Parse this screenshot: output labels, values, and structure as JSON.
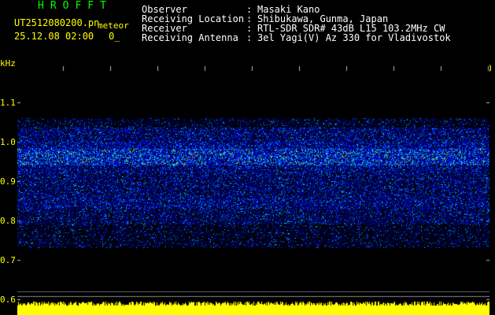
{
  "header": {
    "app_title": "HROFFT",
    "filename": "UT2512080200.pn",
    "meteor_label": "meteor",
    "datetime": "25.12.08 02:00",
    "count": "0_"
  },
  "info": [
    {
      "label": "Observer",
      "value": "Masaki Kano"
    },
    {
      "label": "Receiving Location",
      "value": "Shibukawa, Gunma, Japan"
    },
    {
      "label": "Receiver",
      "value": "RTL-SDR SDR# 43dB L15 103.2MHz CW"
    },
    {
      "label": "Receiving Antenna",
      "value": "3el Yagi(V) Az 330 for Vladivostok"
    }
  ],
  "axis": {
    "y_unit": "kHz",
    "y_ticks": [
      "1.1",
      "1.0",
      "0.9",
      "0.8",
      "0.7",
      "0.6"
    ],
    "x_ticks": [
      "020",
      "020",
      "020",
      "020",
      "020",
      "020",
      "020",
      "020",
      "020",
      "0210"
    ]
  },
  "colors": {
    "text_yellow": "#ffff00",
    "title_green": "#00ff00",
    "info_white": "#ffffff",
    "background": "#000000"
  }
}
